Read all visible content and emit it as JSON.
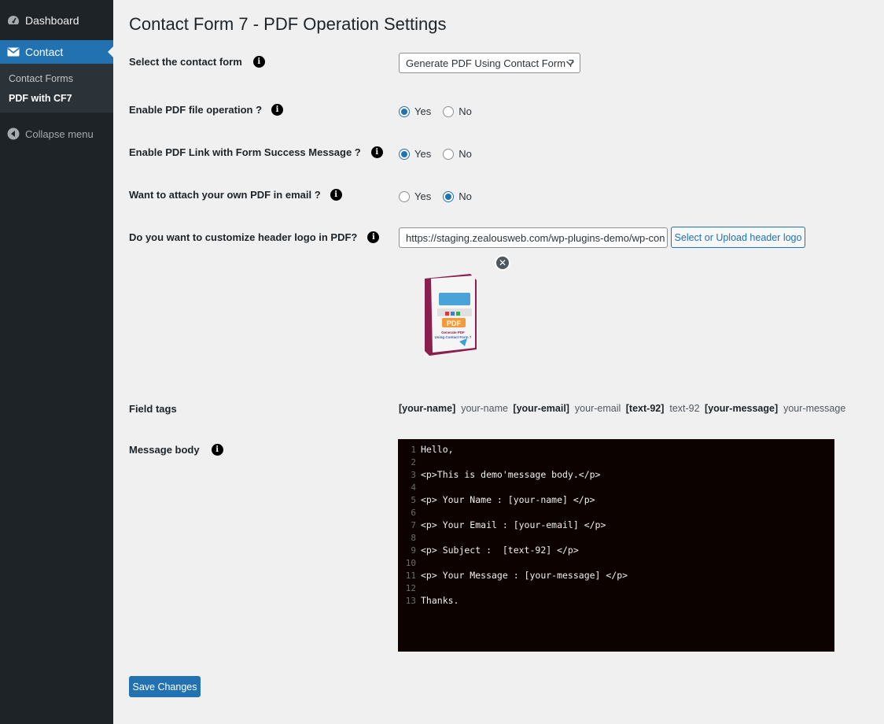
{
  "sidebar": {
    "dashboard": {
      "label": "Dashboard",
      "icon": "dashboard-icon"
    },
    "contact": {
      "label": "Contact",
      "icon": "mail-icon"
    },
    "submenu": [
      {
        "label": "Contact Forms"
      },
      {
        "label": "PDF with CF7",
        "active": true
      }
    ],
    "collapse": {
      "label": "Collapse menu",
      "icon": "collapse-arrow-icon"
    }
  },
  "page": {
    "title": "Contact Form 7 - PDF Operation Settings"
  },
  "settings": {
    "select_form": {
      "label": "Select the contact form",
      "selected": "Generate PDF Using Contact Form 7"
    },
    "enable_pdf": {
      "label": "Enable PDF file operation ?",
      "yes": "Yes",
      "no": "No",
      "value": "yes"
    },
    "enable_link": {
      "label": "Enable PDF Link with Form Success Message ?",
      "yes": "Yes",
      "no": "No",
      "value": "yes"
    },
    "attach_own": {
      "label": "Want to attach your own PDF in email ?",
      "yes": "Yes",
      "no": "No",
      "value": "no"
    },
    "header_logo": {
      "label": "Do you want to customize header logo in PDF?",
      "url": "https://staging.zealousweb.com/wp-plugins-demo/wp-con",
      "button": "Select or Upload header logo",
      "preview_title_line1": "Generate PDF",
      "preview_title_line2": "Using Contact Form 7",
      "preview_badge": "PDF"
    },
    "field_tags": {
      "label": "Field tags",
      "tags": [
        {
          "tag": "[your-name]",
          "name": "your-name"
        },
        {
          "tag": "[your-email]",
          "name": "your-email"
        },
        {
          "tag": "[text-92]",
          "name": "text-92"
        },
        {
          "tag": "[your-message]",
          "name": "your-message"
        }
      ]
    },
    "message_body": {
      "label": "Message body",
      "lines": [
        {
          "n": "1",
          "text": "Hello,"
        },
        {
          "n": "2",
          "text": ""
        },
        {
          "n": "3",
          "text": "<p>This is demo'message body.</p>"
        },
        {
          "n": "4",
          "text": ""
        },
        {
          "n": "5",
          "text": "<p> Your Name : [your-name] </p>"
        },
        {
          "n": "6",
          "text": ""
        },
        {
          "n": "7",
          "text": "<p> Your Email : [your-email] </p>"
        },
        {
          "n": "8",
          "text": ""
        },
        {
          "n": "9",
          "text": "<p> Subject :  [text-92] </p>"
        },
        {
          "n": "10",
          "text": ""
        },
        {
          "n": "11",
          "text": "<p> Your Message : [your-message] </p>"
        },
        {
          "n": "12",
          "text": ""
        },
        {
          "n": "13",
          "text": "Thanks."
        }
      ]
    }
  },
  "actions": {
    "save": "Save Changes"
  },
  "colors": {
    "sidebar_bg": "#1d2327",
    "accent": "#2271b1",
    "editor_bg": "#0c0300"
  }
}
